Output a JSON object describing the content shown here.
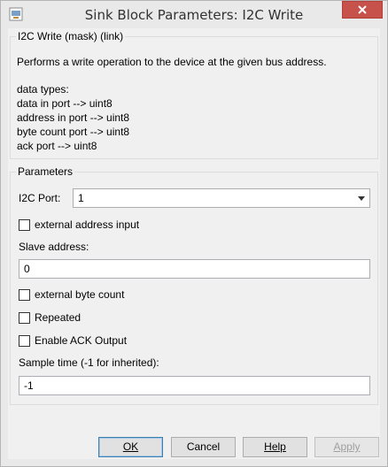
{
  "window": {
    "title": "Sink Block Parameters: I2C Write"
  },
  "mask": {
    "group_title": "I2C Write (mask) (link)",
    "description": "Performs a write operation to the device at the given bus address.",
    "types_heading": "data types:",
    "type_lines": [
      "data in port --> uint8",
      "address in port --> uint8",
      "byte count port --> uint8",
      "ack port  --> uint8"
    ]
  },
  "params": {
    "group_title": "Parameters",
    "i2c_port": {
      "label": "I2C Port:",
      "value": "1"
    },
    "external_address": {
      "label": "external address input",
      "checked": false
    },
    "slave_address": {
      "label": "Slave address:",
      "value": "0"
    },
    "external_byte_count": {
      "label": "external byte count",
      "checked": false
    },
    "repeated": {
      "label": "Repeated",
      "checked": false
    },
    "enable_ack": {
      "label": "Enable ACK Output",
      "checked": false
    },
    "sample_time": {
      "label": "Sample time (-1 for inherited):",
      "value": "-1"
    }
  },
  "buttons": {
    "ok": "OK",
    "cancel": "Cancel",
    "help": "Help",
    "apply": "Apply"
  }
}
